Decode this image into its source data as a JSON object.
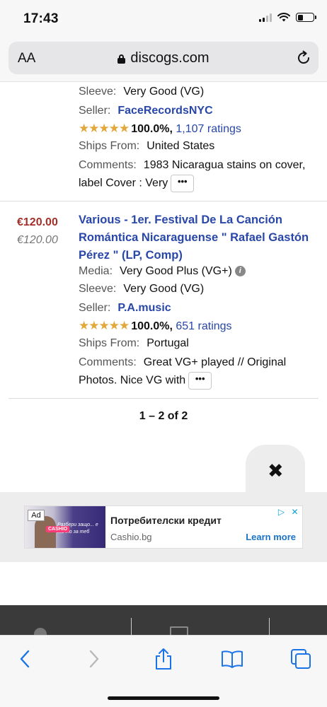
{
  "status_bar": {
    "time": "17:43"
  },
  "browser": {
    "text_size_label": "AA",
    "domain": "discogs.com"
  },
  "listing1": {
    "sleeve_label": "Sleeve:",
    "sleeve_value": "Very Good (VG)",
    "seller_label": "Seller:",
    "seller_name": "FaceRecordsNYC",
    "stars": "★★★★★",
    "rating_pct": "100.0%,",
    "ratings_text": "1,107 ratings",
    "ships_label": "Ships From:",
    "ships_value": "United States",
    "comments_label": "Comments:",
    "comments_line1": "1983 Nicaragua stains on cover,",
    "comments_line2": "label Cover : Very",
    "more_label": "•••"
  },
  "listing2": {
    "price": "€120.00",
    "price_converted": "€120.00",
    "title_line1": "Various - 1er. Festival De La Canción",
    "title_line2": "Romántica Nicaraguense \" Rafael Gastón",
    "title_line3": "Pérez \" (LP, Comp)",
    "media_label": "Media:",
    "media_value": "Very Good Plus (VG+)",
    "info_icon": "i",
    "sleeve_label": "Sleeve:",
    "sleeve_value": "Very Good (VG)",
    "seller_label": "Seller:",
    "seller_name": "P.A.music",
    "stars": "★★★★★",
    "rating_pct": "100.0%,",
    "ratings_text": "651 ratings",
    "ships_label": "Ships From:",
    "ships_value": "Portugal",
    "comments_label": "Comments:",
    "comments_line1": "Great VG+ played // Original",
    "comments_line2": "Photos. Nice VG with",
    "more_label": "•••"
  },
  "pagination": {
    "text": "1 – 2 of 2"
  },
  "close_button": {
    "symbol": "✖"
  },
  "ad": {
    "label": "Ad",
    "image_text": "Разбери защо... е точно за теб",
    "brand_badge": "CASHIO",
    "title": "Потребителски кредит",
    "domain": "Cashio.bg",
    "cta": "Learn more",
    "choices_icon": "▷",
    "close_icon": "✕"
  },
  "icons": {
    "back": "chevron-left-icon",
    "forward": "chevron-right-icon",
    "share": "share-icon",
    "bookmarks": "book-icon",
    "tabs": "tabs-icon"
  },
  "colors": {
    "link": "#2847a8",
    "price": "#a3302a",
    "stars": "#e2a83c",
    "toolbar_icon": "#1a73e8"
  }
}
